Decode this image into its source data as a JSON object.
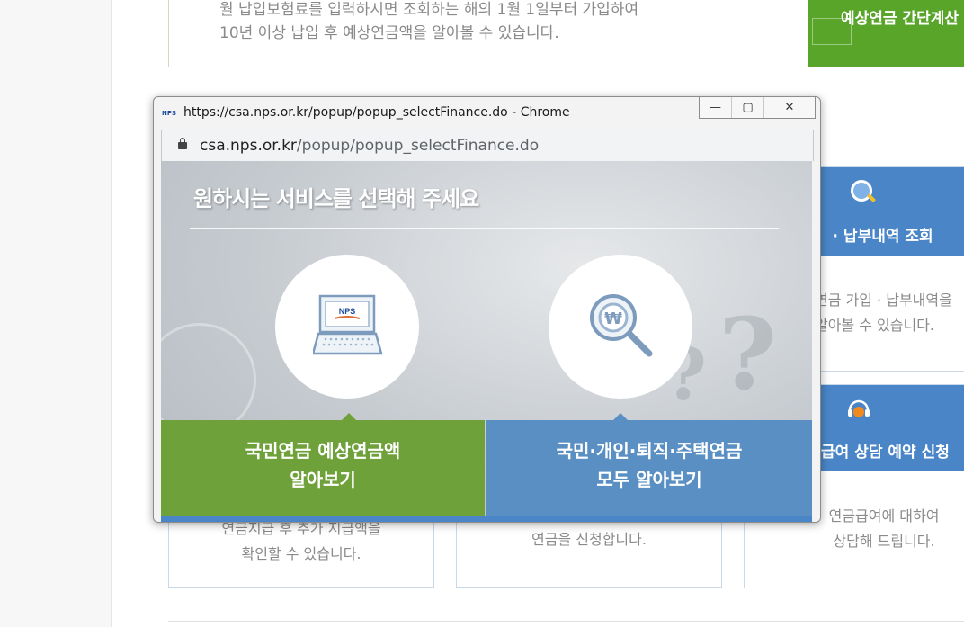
{
  "background": {
    "top_box": {
      "lines": [
        "월 납입보험료를 입력하시면 조회하는 해의 1월 1일부터 가입하여",
        "10년 이상 납입 후 예상연금액을 알아볼 수 있습니다."
      ],
      "button_label": "예상연금 간단계산"
    },
    "cards": [
      {
        "title": "ㅣ · 납부내역 조회",
        "lines": [
          "연금 가입 · 납부내역을",
          "알아볼 수 있습니다."
        ],
        "icon": "magnifier-icon"
      },
      {
        "title": "급여 상담 예약 신청",
        "lines": [
          "연금급여에 대하여",
          "상담해 드립니다."
        ],
        "icon": "headset-icon"
      },
      {
        "lines": [
          "연금지급 후 추가 지급액을",
          "확인할 수 있습니다."
        ]
      },
      {
        "lines": [
          "연금을 신청합니다."
        ]
      }
    ]
  },
  "popup": {
    "window_title": "https://csa.nps.or.kr/popup/popup_selectFinance.do - Chrome",
    "favicon_text": "NPS",
    "address": {
      "host": "csa.nps.or.kr",
      "path": "/popup/popup_selectFinance.do"
    },
    "controls": {
      "minimize": "—",
      "maximize": "▢",
      "close": "✕"
    },
    "heading": "원하시는 서비스를 선택해 주세요",
    "laptop_label": "NPS",
    "options": [
      {
        "lines": [
          "국민연금 예상연금액",
          "알아보기"
        ],
        "color": "#6fa13a",
        "icon": "laptop-icon"
      },
      {
        "lines": [
          "국민·개인·퇴직·주택연금",
          "모두 알아보기"
        ],
        "color": "#5a8fc3",
        "icon": "won-search-icon"
      }
    ]
  }
}
